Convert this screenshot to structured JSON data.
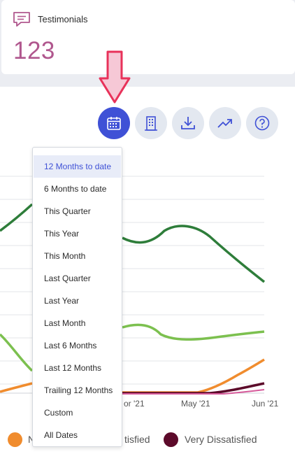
{
  "kpi_card": {
    "title": "Testimonials",
    "value": "123",
    "icon": "comment-icon"
  },
  "toolbar": {
    "buttons": [
      {
        "name": "calendar-icon",
        "active": true
      },
      {
        "name": "building-icon",
        "active": false
      },
      {
        "name": "download-icon",
        "active": false
      },
      {
        "name": "trend-icon",
        "active": false
      },
      {
        "name": "help-icon",
        "active": false
      }
    ]
  },
  "date_menu": {
    "selected": "12 Months to date",
    "items": [
      "12 Months to date",
      "6 Months to date",
      "This Quarter",
      "This Year",
      "This Month",
      "Last Quarter",
      "Last Year",
      "Last Month",
      "Last 6 Months",
      "Last 12 Months",
      "Trailing 12 Months",
      "Custom",
      "All Dates"
    ]
  },
  "chart": {
    "x_ticks": [
      "or '21",
      "May '21",
      "Jun '21"
    ],
    "legend": [
      {
        "label": "N",
        "color": "#f08c2e"
      },
      {
        "label": "tisfied",
        "color": null
      },
      {
        "label": "Very Dissatisfied",
        "color": "#5c0a2a"
      }
    ]
  },
  "colors": {
    "accent": "#3f51d6",
    "kpi_value": "#b0578e",
    "arrow": "#e8325a"
  }
}
